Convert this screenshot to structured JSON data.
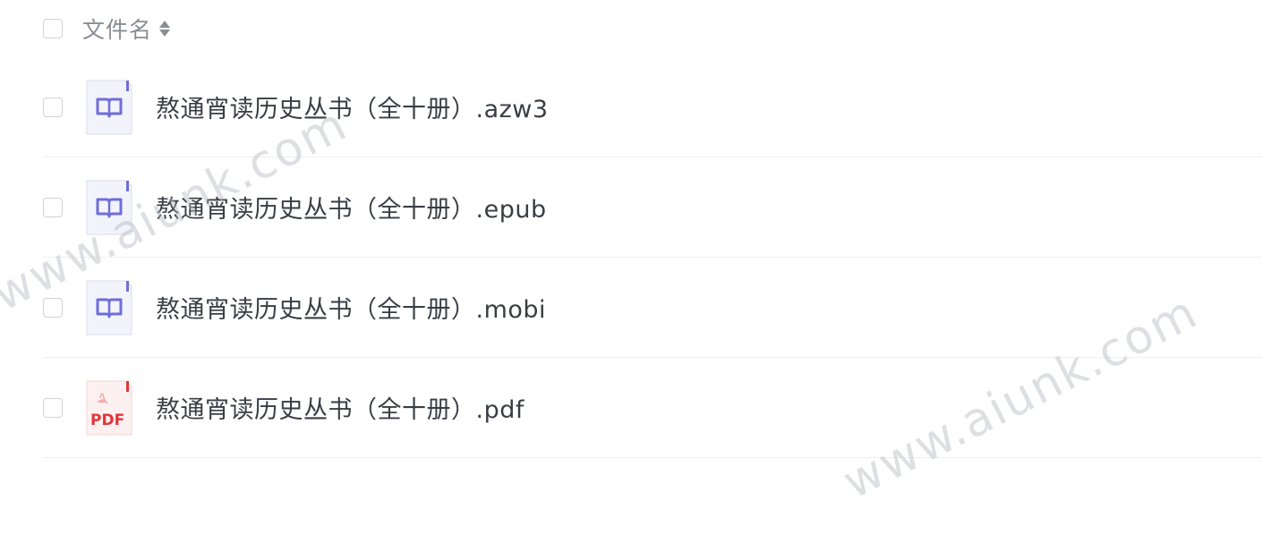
{
  "header": {
    "column_label": "文件名",
    "sort_icon": "sort-icon"
  },
  "files": [
    {
      "name": "熬通宵读历史丛书（全十册）.azw3",
      "icon": "ebook-file-icon"
    },
    {
      "name": "熬通宵读历史丛书（全十册）.epub",
      "icon": "ebook-file-icon"
    },
    {
      "name": "熬通宵读历史丛书（全十册）.mobi",
      "icon": "ebook-file-icon"
    },
    {
      "name": "熬通宵读历史丛书（全十册）.pdf",
      "icon": "pdf-file-icon",
      "icon_text": "PDF"
    }
  ],
  "watermarks": [
    "www.aiunk.com",
    "www.aiunk.com"
  ],
  "colors": {
    "ebook_icon_bg": "#f3f3fb",
    "ebook_icon_accent": "#6f6ed8",
    "pdf_icon_bg": "#fdf0f0",
    "pdf_icon_accent": "#e0363a"
  }
}
